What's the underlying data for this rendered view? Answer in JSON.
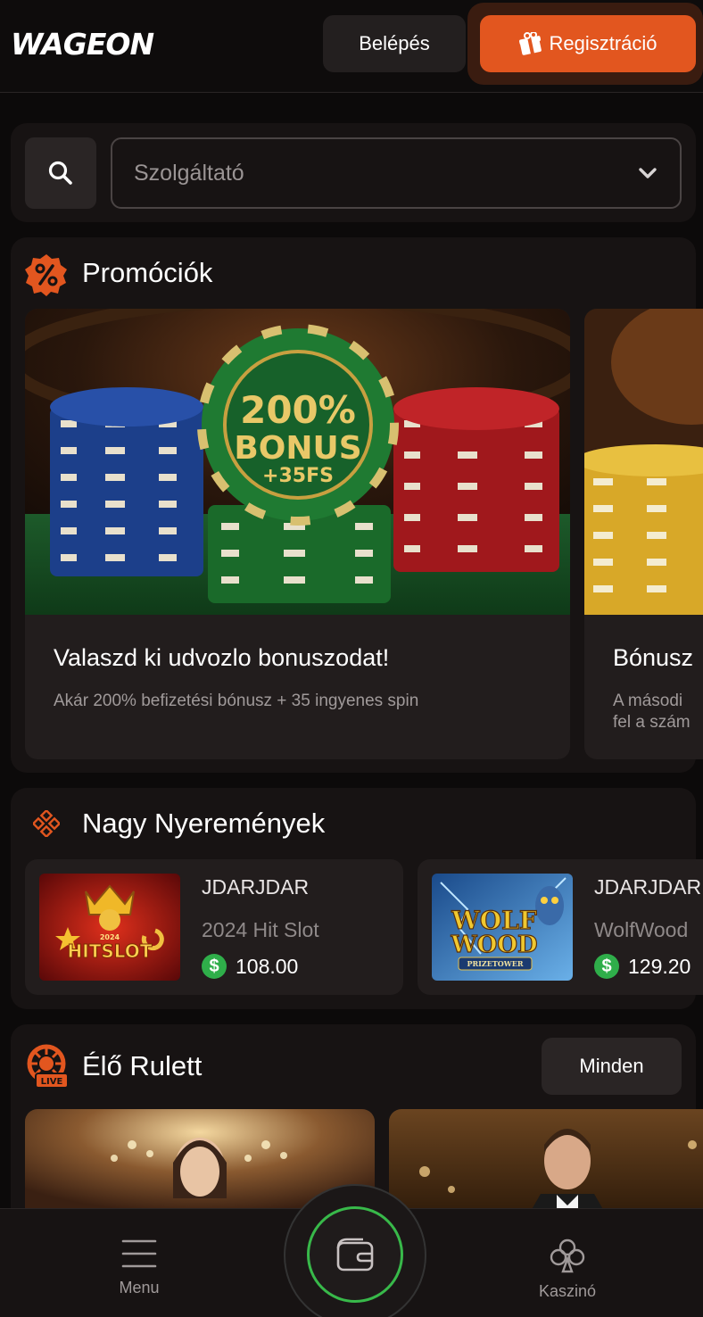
{
  "header": {
    "logo": "WAGEON",
    "login_label": "Belépés",
    "register_label": "Regisztráció"
  },
  "search": {
    "provider_placeholder": "Szolgáltató"
  },
  "promotions": {
    "title": "Promóciók",
    "cards": [
      {
        "title": "Valaszd ki udvozlo bonuszodat!",
        "subtitle": "Akár 200% befizetési bónusz + 35 ingyenes spin",
        "image_text": [
          "200%",
          "BONUS",
          "+35FS"
        ]
      },
      {
        "title": "Bónusz",
        "subtitle_line1": "A másodi",
        "subtitle_line2": "fel a szám"
      }
    ]
  },
  "jackpots": {
    "title": "Nagy Nyeremények",
    "items": [
      {
        "user": "JDARJDAR",
        "game": "2024 Hit Slot",
        "amount": "108.00",
        "thumb_text": "HITSLOT",
        "thumb_year": "2024"
      },
      {
        "user": "JDARJDAR",
        "game": "WolfWood",
        "amount": "129.20",
        "thumb_text": [
          "WOLF",
          "WOOD",
          "PRIZETOWER"
        ]
      }
    ]
  },
  "live_roulette": {
    "title": "Élő Rulett",
    "all_label": "Minden",
    "live_badge": "LIVE"
  },
  "bottom_nav": {
    "menu_label": "Menu",
    "casino_label": "Kaszinó"
  },
  "colors": {
    "accent": "#e2561f",
    "green": "#38b94a",
    "background": "#0c0a0a",
    "panel": "#171313"
  }
}
